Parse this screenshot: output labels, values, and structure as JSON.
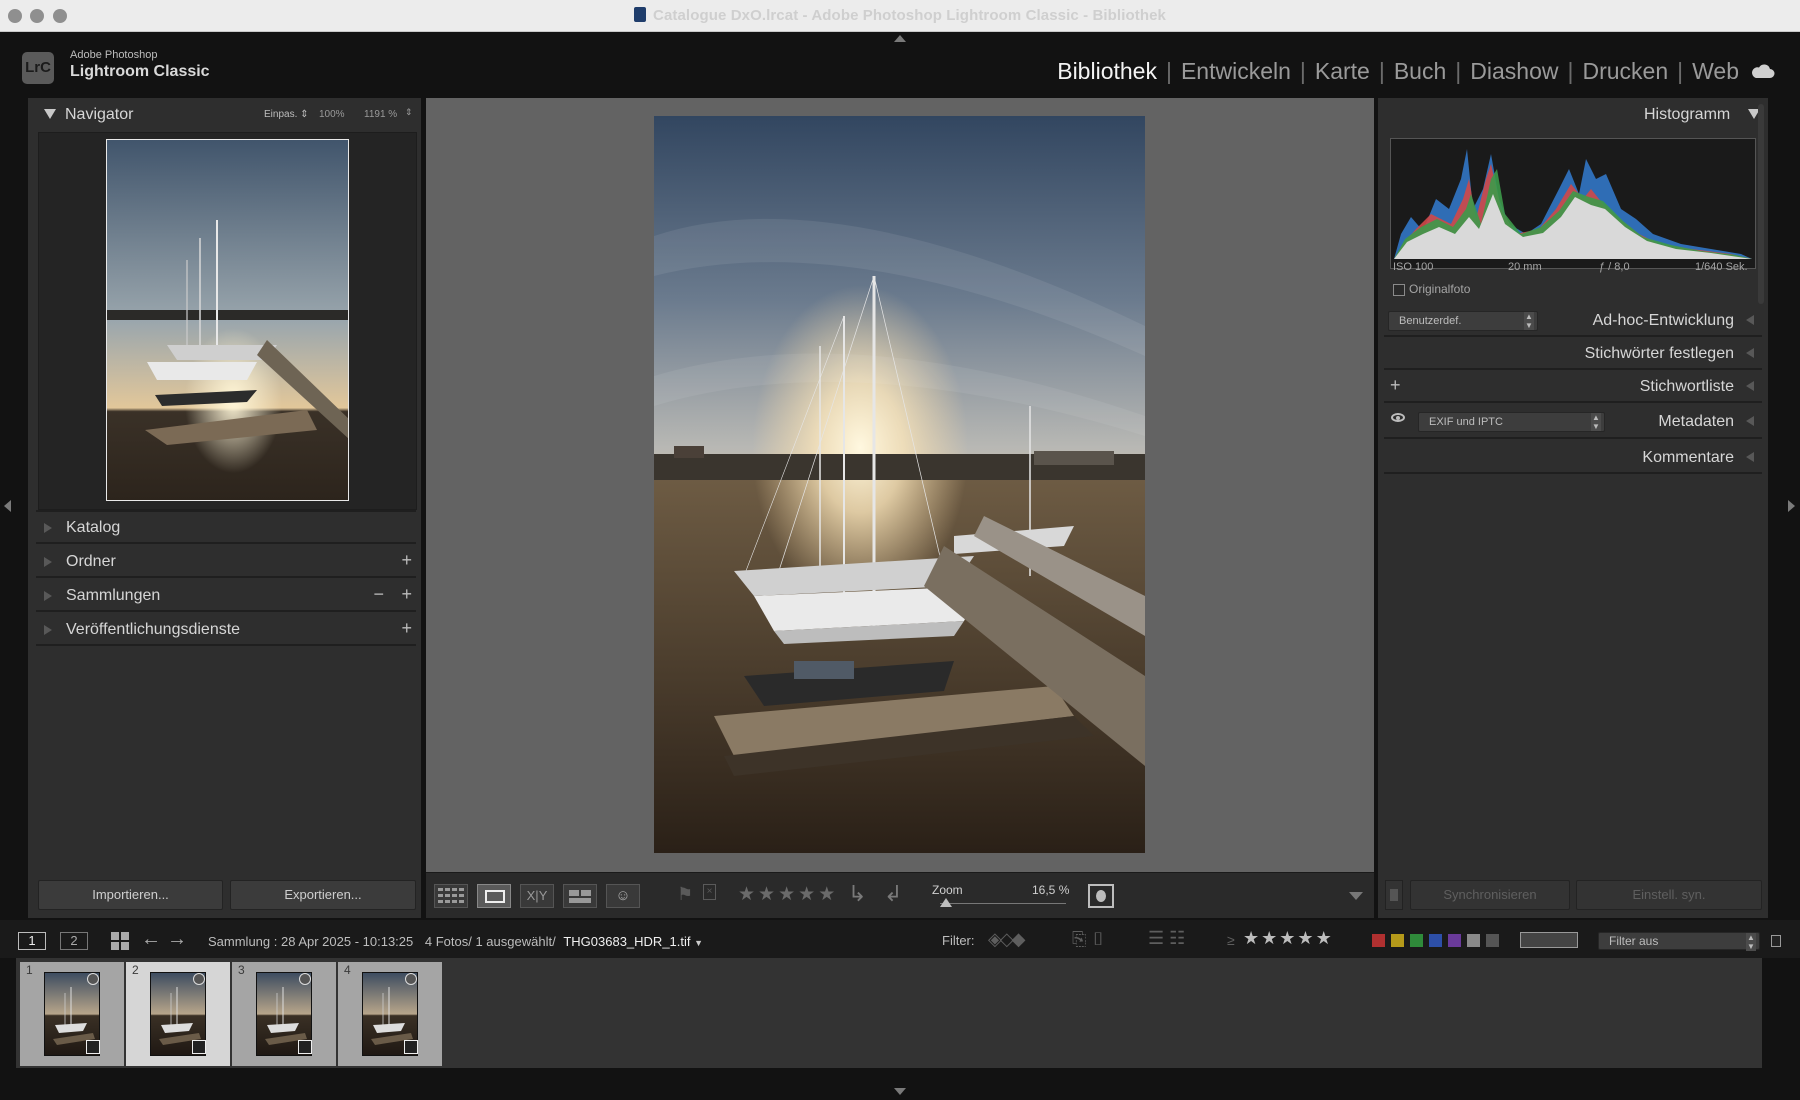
{
  "window": {
    "title": "Catalogue DxO.lrcat - Adobe Photoshop Lightroom Classic - Bibliothek"
  },
  "identity": {
    "logo": "LrC",
    "line1": "Adobe Photoshop",
    "line2": "Lightroom Classic"
  },
  "modules": [
    "Bibliothek",
    "Entwickeln",
    "Karte",
    "Buch",
    "Diashow",
    "Drucken",
    "Web"
  ],
  "active_module": "Bibliothek",
  "navigator": {
    "title": "Navigator",
    "fit": "Einpas.",
    "zoom1": "100%",
    "zoom2": "1191 %"
  },
  "left_sections": [
    {
      "label": "Katalog",
      "plus": "",
      "minus": ""
    },
    {
      "label": "Ordner",
      "plus": "+",
      "minus": ""
    },
    {
      "label": "Sammlungen",
      "plus": "+",
      "minus": "−"
    },
    {
      "label": "Veröffentlichungsdienste",
      "plus": "+",
      "minus": ""
    }
  ],
  "left_buttons": {
    "import": "Importieren...",
    "export": "Exportieren..."
  },
  "histogram": {
    "title": "Histogramm",
    "iso": "ISO 100",
    "focal": "20 mm",
    "aperture": "ƒ / 8,0",
    "shutter": "1/640 Sek.",
    "original": "Originalfoto"
  },
  "right_sections": {
    "quick_develop": {
      "preset": "Benutzerdef.",
      "label": "Ad-hoc-Entwicklung"
    },
    "keywording": "Stichwörter festlegen",
    "keyword_list": {
      "plus": "+",
      "label": "Stichwortliste"
    },
    "metadata": {
      "preset": "EXIF und IPTC",
      "label": "Metadaten"
    },
    "comments": "Kommentare"
  },
  "right_buttons": {
    "sync": "Synchronisieren",
    "sync_settings": "Einstell. syn."
  },
  "toolbar": {
    "zoom_label": "Zoom",
    "zoom_value": "16,5 %",
    "stars": [
      "★",
      "★",
      "★",
      "★",
      "★"
    ],
    "zoom_level": 0.05
  },
  "filmbar": {
    "screen1": "1",
    "screen2": "2",
    "source": "Sammlung : 28 Apr 2025 - 10:13:25",
    "count": "4 Fotos/",
    "selected": "1 ausgewählt/",
    "filename": "THG03683_HDR_1.tif",
    "filter_label": "Filter:",
    "filter_ge": "≥",
    "filter_stars": [
      "★",
      "★",
      "★",
      "★",
      "★"
    ],
    "filter_value": "Filter aus"
  },
  "filter_colors": [
    "#b03030",
    "#b59a1a",
    "#2f8a3a",
    "#2d4fa8",
    "#6a3a9a",
    "#8a8a8a",
    "#555555"
  ],
  "filmstrip": [
    {
      "num": "1",
      "selected": false
    },
    {
      "num": "2",
      "selected": true
    },
    {
      "num": "3",
      "selected": false
    },
    {
      "num": "4",
      "selected": false
    }
  ]
}
